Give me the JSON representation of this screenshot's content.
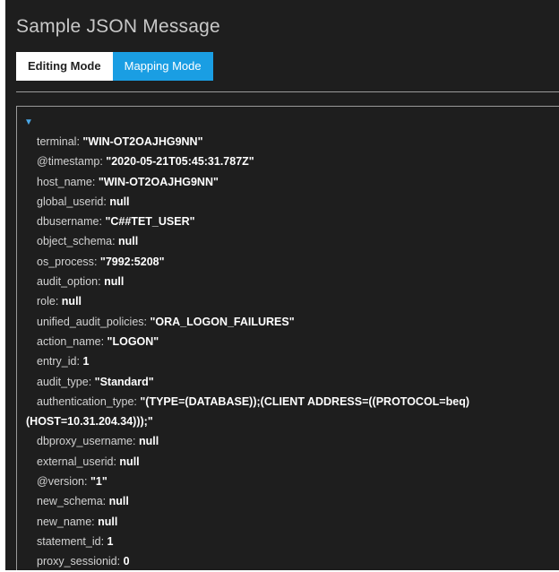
{
  "panel": {
    "title": "Sample JSON Message",
    "tabs": [
      {
        "label": "Editing Mode"
      },
      {
        "label": "Mapping Mode"
      }
    ],
    "toggle_icon": "▼"
  },
  "json_lines": [
    {
      "key": "terminal",
      "value": "\"WIN-OT2OAJHG9NN\""
    },
    {
      "key": "@timestamp",
      "value": "\"2020-05-21T05:45:31.787Z\""
    },
    {
      "key": "host_name",
      "value": "\"WIN-OT2OAJHG9NN\""
    },
    {
      "key": "global_userid",
      "value": "null"
    },
    {
      "key": "dbusername",
      "value": "\"C##TET_USER\""
    },
    {
      "key": "object_schema",
      "value": "null"
    },
    {
      "key": "os_process",
      "value": "\"7992:5208\""
    },
    {
      "key": "audit_option",
      "value": "null"
    },
    {
      "key": "role",
      "value": "null"
    },
    {
      "key": "unified_audit_policies",
      "value": "\"ORA_LOGON_FAILURES\""
    },
    {
      "key": "action_name",
      "value": "\"LOGON\""
    },
    {
      "key": "entry_id",
      "value": "1"
    },
    {
      "key": "audit_type",
      "value": "\"Standard\""
    },
    {
      "key": "authentication_type",
      "value": "\"(TYPE=(DATABASE));(CLIENT ADDRESS=((PROTOCOL=beq)"
    },
    {
      "continuation": "(HOST=10.31.204.34)));\""
    },
    {
      "key": "dbproxy_username",
      "value": "null"
    },
    {
      "key": "external_userid",
      "value": "null"
    },
    {
      "key": "@version",
      "value": "\"1\""
    },
    {
      "key": "new_schema",
      "value": "null"
    },
    {
      "key": "new_name",
      "value": "null"
    },
    {
      "key": "statement_id",
      "value": "1"
    },
    {
      "key": "proxy_sessionid",
      "value": "0"
    }
  ]
}
